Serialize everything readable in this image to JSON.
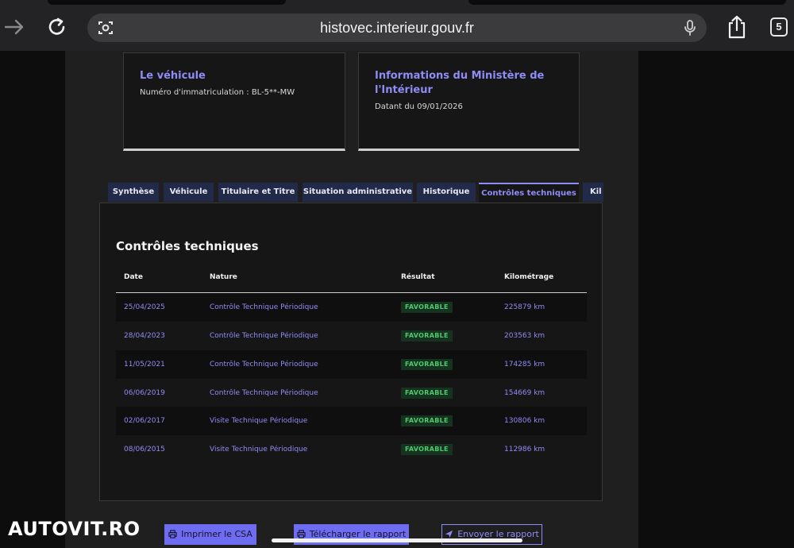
{
  "browser": {
    "url": "histovec.interieur.gouv.fr",
    "tab_count": "5"
  },
  "cards": {
    "vehicle": {
      "title": "Le véhicule",
      "line": "Numéro d'immatriculation : BL-5**-MW"
    },
    "ministry": {
      "title_line1": "Informations du Ministère de",
      "title_line2": "l'Intérieur",
      "line": "Datant du 09/01/2026"
    }
  },
  "tabs": [
    "Synthèse",
    "Véhicule",
    "Titulaire et Titre",
    "Situation administrative",
    "Historique",
    "Contrôles techniques",
    "Kil"
  ],
  "active_tab": "Contrôles techniques",
  "section": {
    "title": "Contrôles techniques",
    "columns": [
      "Date",
      "Nature",
      "Résultat",
      "Kilométrage"
    ],
    "rows": [
      {
        "date": "25/04/2025",
        "nature": "Contrôle Technique Périodique",
        "result": "FAVORABLE",
        "km": "225879 km"
      },
      {
        "date": "28/04/2023",
        "nature": "Contrôle Technique Périodique",
        "result": "FAVORABLE",
        "km": "203563 km"
      },
      {
        "date": "11/05/2021",
        "nature": "Contrôle Technique Périodique",
        "result": "FAVORABLE",
        "km": "174285 km"
      },
      {
        "date": "06/06/2019",
        "nature": "Contrôle Technique Périodique",
        "result": "FAVORABLE",
        "km": "154669 km"
      },
      {
        "date": "02/06/2017",
        "nature": "Visite Technique Périodique",
        "result": "FAVORABLE",
        "km": "130806 km"
      },
      {
        "date": "08/06/2015",
        "nature": "Visite Technique Périodique",
        "result": "FAVORABLE",
        "km": "112986 km"
      }
    ]
  },
  "actions": {
    "print": "Imprimer le CSA",
    "download": "Télécharger le rapport",
    "send": "Envoyer le rapport"
  },
  "watermark": "AUTOVIT.RO",
  "colors": {
    "accent": "#8f8cf5",
    "success": "#4ec96e",
    "tab_bg": "#222a4a"
  },
  "icons": [
    "forward-icon",
    "reload-icon",
    "lens-icon",
    "mic-icon",
    "share-icon",
    "printer-icon",
    "send-icon"
  ]
}
